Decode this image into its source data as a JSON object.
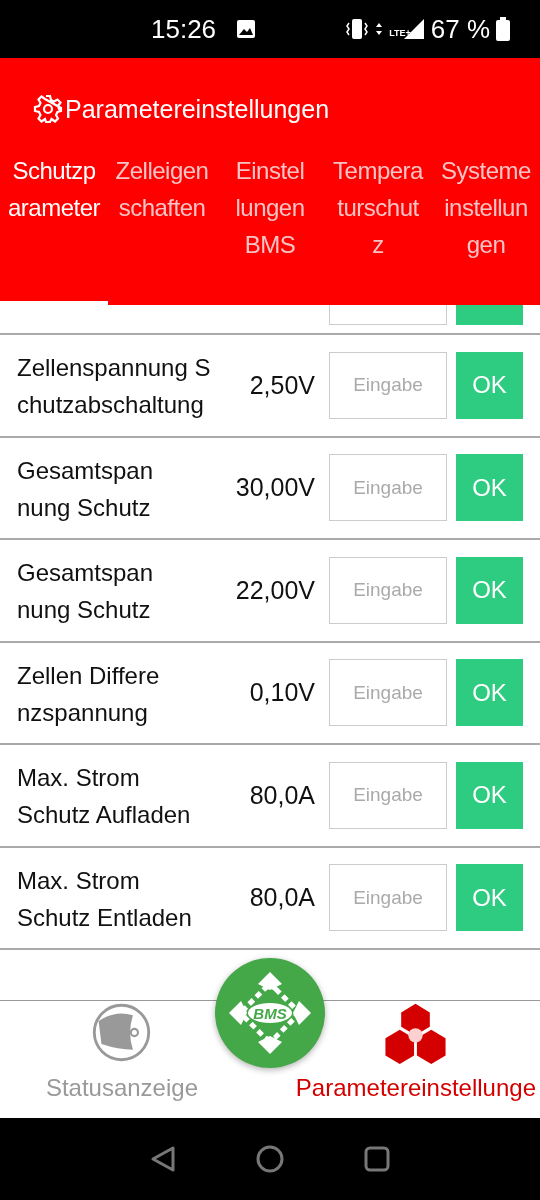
{
  "status_bar": {
    "time": "15:26",
    "network": "LTE+",
    "battery": "67 %"
  },
  "header": {
    "title": "Parametereinstellungen"
  },
  "tabs": [
    {
      "lines": [
        "Schutzp",
        "arameter"
      ],
      "selected": true
    },
    {
      "lines": [
        "Zelleigen",
        "schaften"
      ],
      "selected": false
    },
    {
      "lines": [
        "Einstel",
        "lungen",
        "BMS"
      ],
      "selected": false
    },
    {
      "lines": [
        "Tempera",
        "turschut",
        "z"
      ],
      "selected": false
    },
    {
      "lines": [
        "Systeme",
        "instellun",
        "gen"
      ],
      "selected": false
    }
  ],
  "rows": [
    {
      "lines": [
        "Zellenspannung S",
        "chutzabschaltung"
      ],
      "value": "2,50V",
      "placeholder": "Eingabe",
      "button": "OK"
    },
    {
      "lines": [
        "Gesamtspan",
        "nung Schutz"
      ],
      "value": "30,00V",
      "placeholder": "Eingabe",
      "button": "OK"
    },
    {
      "lines": [
        "Gesamtspan",
        "nung Schutz"
      ],
      "value": "22,00V",
      "placeholder": "Eingabe",
      "button": "OK"
    },
    {
      "lines": [
        "Zellen Differe",
        "nzspannung"
      ],
      "value": "0,10V",
      "placeholder": "Eingabe",
      "button": "OK"
    },
    {
      "lines": [
        "Max. Strom",
        "Schutz Aufladen"
      ],
      "value": "80,0A",
      "placeholder": "Eingabe",
      "button": "OK"
    },
    {
      "lines": [
        "Max. Strom",
        "Schutz Entladen"
      ],
      "value": "80,0A",
      "placeholder": "Eingabe",
      "button": "OK"
    }
  ],
  "fab": {
    "label": "BMS"
  },
  "nav": [
    {
      "kind": "status",
      "label": "Statusanzeige",
      "selected": false
    },
    {
      "kind": "params",
      "label": "Parametereinstellunge",
      "selected": true
    }
  ]
}
